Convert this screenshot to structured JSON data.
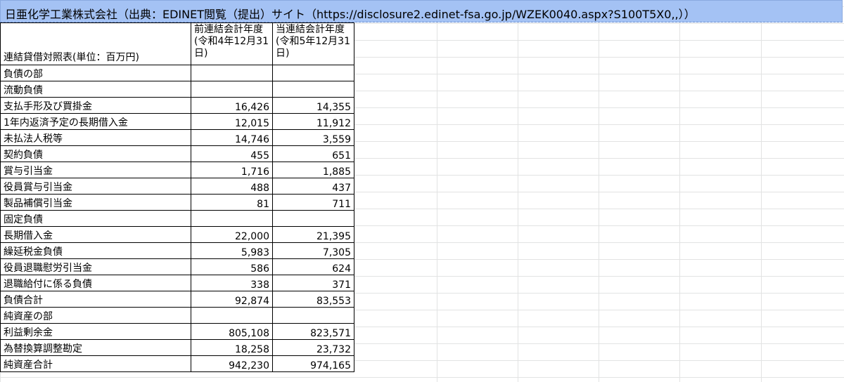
{
  "title": "日亜化学工業株式会社（出典：EDINET閲覧（提出）サイト（https://disclosure2.edinet-fsa.go.jp/WZEK0040.aspx?S100T5X0,,））",
  "table": {
    "header_label": "連結貸借対照表(単位：百万円)",
    "col_prev": "前連結会計年度(令和4年12月31日)",
    "col_curr": "当連結会計年度(令和5年12月31日)",
    "rows": [
      {
        "label": "負債の部",
        "prev": "",
        "curr": ""
      },
      {
        "label": "流動負債",
        "prev": "",
        "curr": ""
      },
      {
        "label": "支払手形及び買掛金",
        "prev": "16,426",
        "curr": "14,355"
      },
      {
        "label": "1年内返済予定の長期借入金",
        "prev": "12,015",
        "curr": "11,912"
      },
      {
        "label": "未払法人税等",
        "prev": "14,746",
        "curr": "3,559"
      },
      {
        "label": "契約負債",
        "prev": "455",
        "curr": "651"
      },
      {
        "label": "賞与引当金",
        "prev": "1,716",
        "curr": "1,885"
      },
      {
        "label": "役員賞与引当金",
        "prev": "488",
        "curr": "437"
      },
      {
        "label": "製品補償引当金",
        "prev": "81",
        "curr": "711"
      },
      {
        "label": "固定負債",
        "prev": "",
        "curr": ""
      },
      {
        "label": "長期借入金",
        "prev": "22,000",
        "curr": "21,395"
      },
      {
        "label": "繰延税金負債",
        "prev": "5,983",
        "curr": "7,305"
      },
      {
        "label": "役員退職慰労引当金",
        "prev": "586",
        "curr": "624"
      },
      {
        "label": "退職給付に係る負債",
        "prev": "338",
        "curr": "371"
      },
      {
        "label": "負債合計",
        "prev": "92,874",
        "curr": "83,553"
      },
      {
        "label": "純資産の部",
        "prev": "",
        "curr": ""
      },
      {
        "label": "利益剰余金",
        "prev": "805,108",
        "curr": "823,571"
      },
      {
        "label": "為替換算調整勘定",
        "prev": "18,258",
        "curr": "23,732"
      },
      {
        "label": "純資産合計",
        "prev": "942,230",
        "curr": "974,165"
      }
    ]
  },
  "colors": {
    "title_bg": "#a4c2f4",
    "gridline": "#e2e3e3",
    "cell_border": "#000000"
  }
}
